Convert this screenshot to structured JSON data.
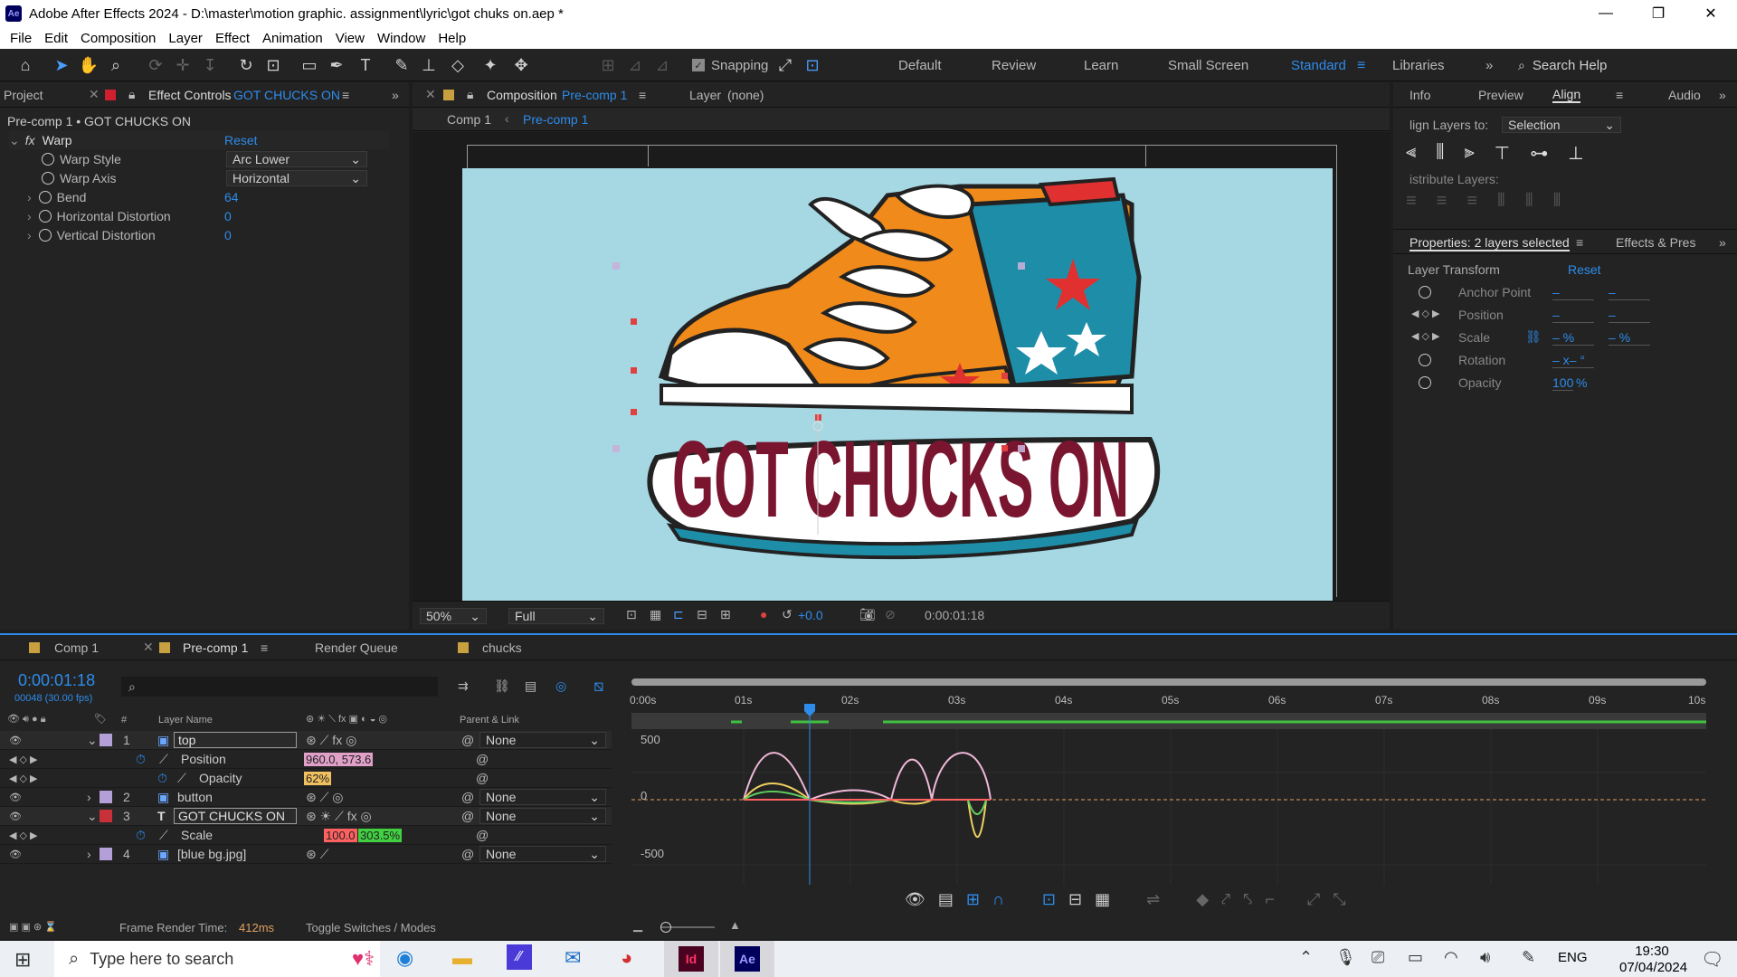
{
  "window": {
    "title": "Adobe After Effects 2024 - D:\\master\\motion graphic. assignment\\lyric\\got chuks on.aep *",
    "app_icon": "Ae"
  },
  "menu": [
    "File",
    "Edit",
    "Composition",
    "Layer",
    "Effect",
    "Animation",
    "View",
    "Window",
    "Help"
  ],
  "toolbar": {
    "snapping_label": "Snapping",
    "workspaces": [
      "Default",
      "Review",
      "Learn",
      "Small Screen",
      "Standard",
      "Libraries"
    ],
    "active_workspace": "Standard",
    "search_placeholder": "Search Help"
  },
  "effect_panel": {
    "tab_project": "Project",
    "tab_effect_prefix": "Effect Controls",
    "tab_effect_layer": "GOT CHUCKS ON",
    "breadcrumb": "Pre-comp 1 • GOT CHUCKS ON",
    "effect_name": "Warp",
    "reset": "Reset",
    "props": [
      {
        "label": "Warp Style",
        "value": "Arc Lower",
        "type": "dropdown"
      },
      {
        "label": "Warp Axis",
        "value": "Horizontal",
        "type": "dropdown"
      },
      {
        "label": "Bend",
        "value": "64",
        "type": "number"
      },
      {
        "label": "Horizontal Distortion",
        "value": "0",
        "type": "number"
      },
      {
        "label": "Vertical Distortion",
        "value": "0",
        "type": "number"
      }
    ]
  },
  "comp_panel": {
    "tab_prefix": "Composition",
    "tab_comp": "Pre-comp 1",
    "layer_tab": "Layer",
    "layer_value": "(none)",
    "crumbs": [
      "Comp 1",
      "Pre-comp 1"
    ],
    "artwork_text": "GOT CHUCKS ON",
    "zoom": "50%",
    "resolution": "Full",
    "exposure": "+0.0",
    "timecode": "0:00:01:18"
  },
  "right_panel": {
    "tabs": [
      "Info",
      "Preview",
      "Align",
      "Audio"
    ],
    "active_tab": "Align",
    "align_layers_to_label": "lign Layers to:",
    "align_layers_to_value": "Selection",
    "distribute_label": "istribute Layers:",
    "props_tab": "Properties: 2 layers selected",
    "effects_tab": "Effects & Pres",
    "layer_transform": "Layer Transform",
    "reset": "Reset",
    "transform": [
      {
        "label": "Anchor Point",
        "v1": "–",
        "v2": "–"
      },
      {
        "label": "Position",
        "v1": "–",
        "v2": "–"
      },
      {
        "label": "Scale",
        "v1": "– %",
        "v2": "– %"
      },
      {
        "label": "Rotation",
        "v1": "– x– °",
        "v2": ""
      },
      {
        "label": "Opacity",
        "v1": "100",
        "v2": "%"
      }
    ]
  },
  "timeline": {
    "tabs": [
      "Comp 1",
      "Pre-comp 1",
      "Render Queue",
      "chucks"
    ],
    "active_tab": "Pre-comp 1",
    "timecode": "0:00:01:18",
    "frame_info": "00048 (30.00 fps)",
    "col_layer_name": "Layer Name",
    "col_parent": "Parent & Link",
    "col_num": "#",
    "layers": [
      {
        "num": "1",
        "name": "top",
        "parent": "None",
        "color": "#b4a0d8",
        "expanded": true
      },
      {
        "prop": "Position",
        "value": "960.0, 573.6",
        "color": "#e0a0c8"
      },
      {
        "prop": "Opacity",
        "value": "62%",
        "color": "#f0c060"
      },
      {
        "num": "2",
        "name": "button",
        "parent": "None",
        "color": "#b4a0d8",
        "expanded": false
      },
      {
        "num": "3",
        "name": "GOT CHUCKS ON",
        "parent": "None",
        "color": "#c8303a",
        "expanded": true
      },
      {
        "prop": "Scale",
        "value1": "100.0",
        "value2": "303.5%",
        "color1": "#ff6060",
        "color2": "#40d040"
      },
      {
        "num": "4",
        "name": "[blue bg.jpg]",
        "parent": "None",
        "color": "#b4a0d8",
        "expanded": false
      }
    ],
    "ruler": [
      "0:00s",
      "01s",
      "02s",
      "03s",
      "04s",
      "05s",
      "06s",
      "07s",
      "08s",
      "09s",
      "10s"
    ],
    "graph_labels": [
      "500",
      "0",
      "-500"
    ],
    "frame_render_label": "Frame Render Time:",
    "frame_render_value": "412ms",
    "toggle_label": "Toggle Switches / Modes"
  },
  "taskbar": {
    "search_placeholder": "Type here to search",
    "lang": "ENG",
    "time": "19:30",
    "date": "07/04/2024"
  }
}
